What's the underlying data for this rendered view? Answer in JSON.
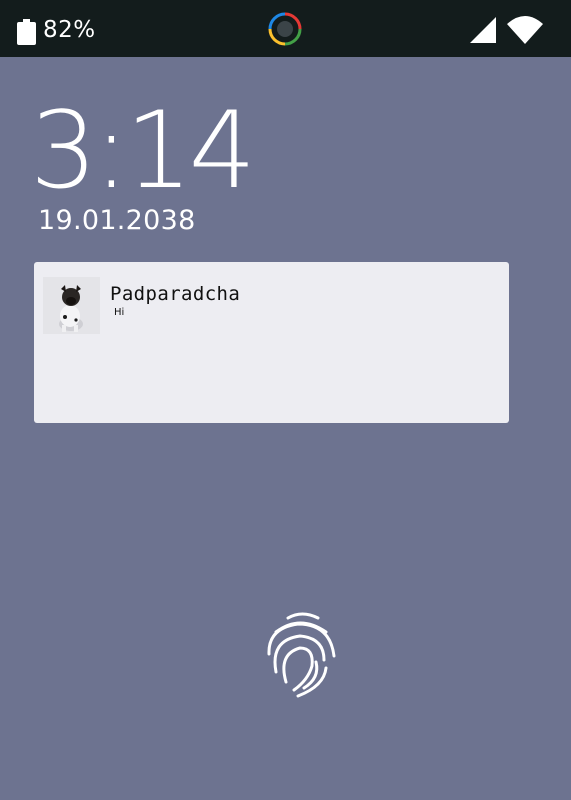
{
  "status_bar": {
    "battery_percent": "82%",
    "battery_icon": "battery-icon",
    "camera_icon": "camera-icon",
    "signal_icon": "cellular-signal-icon",
    "wifi_icon": "wifi-icon"
  },
  "lock_screen": {
    "time": "3:14",
    "date": "19.01.2038"
  },
  "notification": {
    "title": "Padparadcha",
    "body": "Hi",
    "avatar_icon": "pug-avatar"
  },
  "fingerprint_icon": "fingerprint-icon",
  "colors": {
    "background": "#6d7390",
    "status_bar": "#131c1c",
    "card": "#ededf2"
  }
}
